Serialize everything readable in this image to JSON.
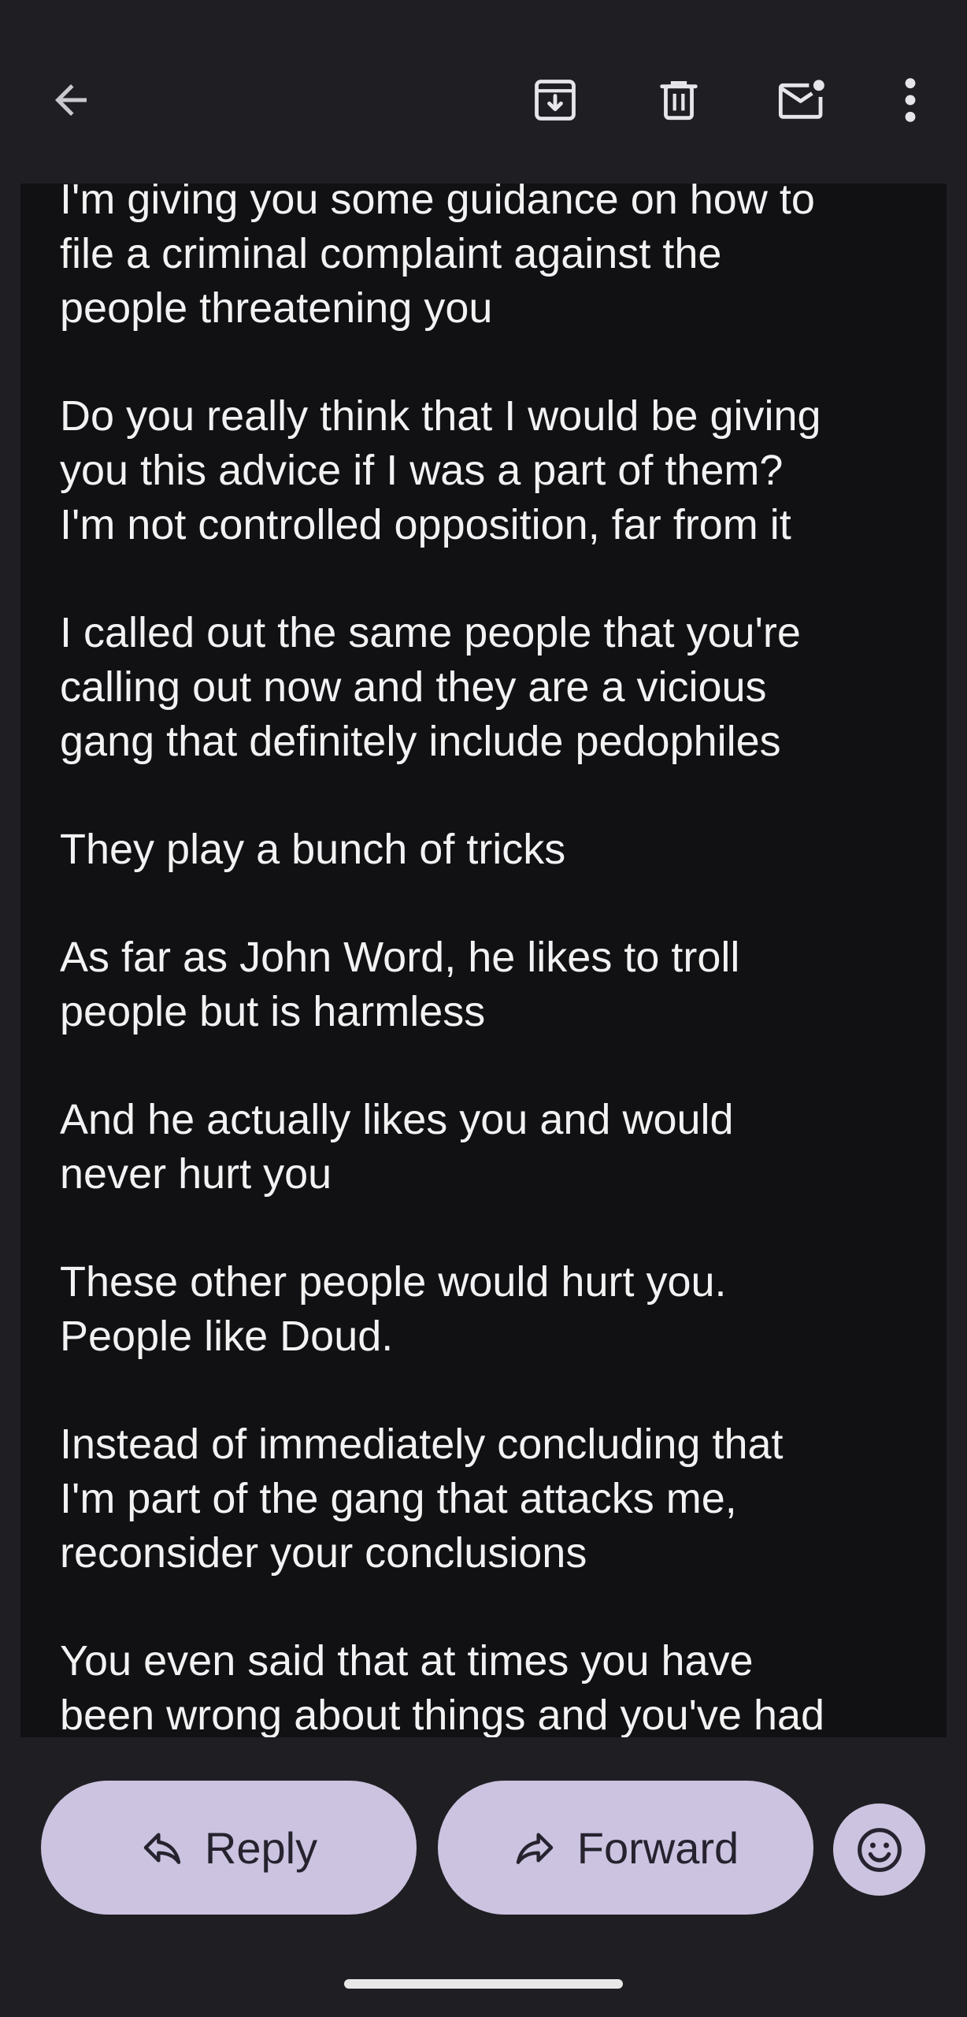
{
  "toolbar": {
    "back_icon": "arrow-left-icon",
    "archive_icon": "archive-icon",
    "delete_icon": "trash-icon",
    "mark_unread_icon": "mail-unread-icon",
    "more_icon": "more-vert-icon"
  },
  "message": {
    "paragraphs": [
      "I'm giving you some guidance on how to\nfile a criminal complaint against the\npeople threatening you",
      "Do you really think that I would be giving\nyou this advice if I was a part of them?\nI'm not controlled opposition, far from it",
      "I called out the same people that you're\ncalling out now and they are a vicious\ngang that definitely include pedophiles",
      "They play a bunch of tricks",
      "As far as John Word, he likes to troll\npeople but is harmless",
      "And he actually likes you and would\nnever hurt you",
      "These other people would hurt you.\nPeople like Doud.",
      "Instead of immediately concluding that\nI'm part of the gang that attacks me,\nreconsider your conclusions",
      "You even said that at times you have\nbeen wrong about things and you've had"
    ]
  },
  "actions": {
    "reply_label": "Reply",
    "forward_label": "Forward",
    "reply_icon": "reply-icon",
    "forward_icon": "forward-icon",
    "emoji_icon": "emoji-smile-icon"
  },
  "colors": {
    "background": "#1f1f23",
    "message_background": "#111114",
    "text": "#f2f2f2",
    "pill": "#cbc3e0",
    "pill_text": "#26232f"
  }
}
